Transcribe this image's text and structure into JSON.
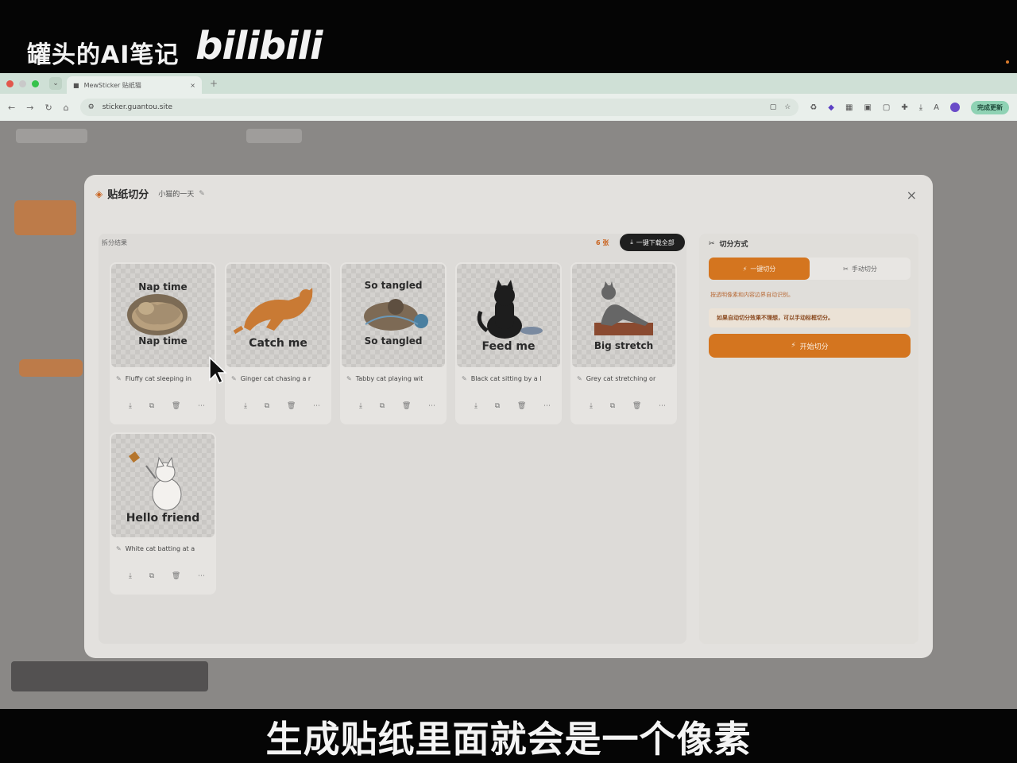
{
  "video": {
    "channel_watermark": "罐头的AI笔记",
    "platform_logo": "bilibili",
    "subtitle": "生成贴纸里面就会是一个像素"
  },
  "browser": {
    "tab_title": "MewSticker 贴纸猫",
    "url": "sticker.guantou.site",
    "update_button": "完成更新"
  },
  "modal": {
    "title": "贴纸切分",
    "project_name": "小猫的一天",
    "results_label": "拆分结果",
    "count": "6 张",
    "download_all": "一键下载全部",
    "cards": [
      {
        "caption": "Nap time",
        "caption_top": "Nap time",
        "description": "Fluffy cat sleeping in"
      },
      {
        "caption": "Catch me",
        "caption_top": "",
        "description": "Ginger cat chasing a r"
      },
      {
        "caption": "So tangled",
        "caption_top": "So tangled",
        "description": "Tabby cat playing wit"
      },
      {
        "caption": "Feed me",
        "caption_top": "",
        "description": "Black cat sitting by a l"
      },
      {
        "caption": "Big stretch",
        "caption_top": "",
        "description": "Grey cat stretching or"
      },
      {
        "caption": "Hello friend",
        "caption_top": "",
        "description": "White cat batting at a"
      }
    ],
    "split_method": {
      "title": "切分方式",
      "auto_label": "一键切分",
      "manual_label": "手动切分",
      "hint": "按透明像素和内容边界自动识别。",
      "warning": "如果自动切分效果不理想，可以手动标框切分。",
      "start_button": "开始切分"
    }
  }
}
